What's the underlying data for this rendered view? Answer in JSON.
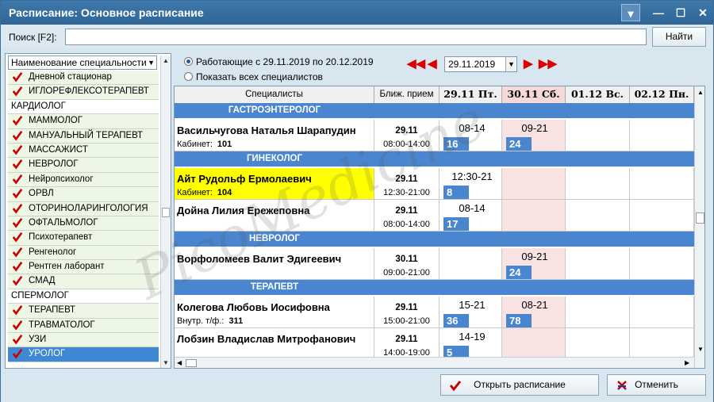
{
  "window": {
    "title": "Расписание:  Основное расписание"
  },
  "search": {
    "label": "Поиск [F2]:",
    "value": "",
    "button": "Найти"
  },
  "specialties": {
    "header": "Наименование специальности",
    "items": [
      {
        "label": "Дневной стационар",
        "checked": true
      },
      {
        "label": "ИГЛОРЕФЛЕКСОТЕРАПЕВТ",
        "checked": true
      },
      {
        "label": "КАРДИОЛОГ",
        "checked": false
      },
      {
        "label": "МАММОЛОГ",
        "checked": true
      },
      {
        "label": "МАНУАЛЬНЫЙ ТЕРАПЕВТ",
        "checked": true
      },
      {
        "label": "МАССАЖИСТ",
        "checked": true
      },
      {
        "label": "НЕВРОЛОГ",
        "checked": true
      },
      {
        "label": "Нейропсихолог",
        "checked": true
      },
      {
        "label": "ОРВЛ",
        "checked": true
      },
      {
        "label": "ОТОРИНОЛАРИНГОЛОГИЯ",
        "checked": true
      },
      {
        "label": "ОФТАЛЬМОЛОГ",
        "checked": true
      },
      {
        "label": "Психотерапевт",
        "checked": true
      },
      {
        "label": "Ренгенолог",
        "checked": true
      },
      {
        "label": "Рентген лаборант",
        "checked": true
      },
      {
        "label": "СМАД",
        "checked": true
      },
      {
        "label": "СПЕРМОЛОГ",
        "checked": false
      },
      {
        "label": "ТЕРАПЕВТ",
        "checked": true
      },
      {
        "label": "ТРАВМАТОЛОГ",
        "checked": true
      },
      {
        "label": "УЗИ",
        "checked": true
      },
      {
        "label": "УРОЛОГ",
        "checked": true,
        "selected": true
      }
    ]
  },
  "filter": {
    "option1": "Работающие с 29.11.2019 по 20.12.2019",
    "option2": "Показать всех специалистов",
    "date": "29.11.2019"
  },
  "grid": {
    "columns": [
      "Специалисты",
      "Ближ. прием",
      "29.11 Пт.",
      "30.11 Сб.",
      "01.12 Вс.",
      "02.12 Пн."
    ],
    "rows": [
      {
        "type": "group",
        "label": "ГАСТРОЭНТЕРОЛОГ"
      },
      {
        "type": "doc",
        "name": "Васильчугова Наталья Шарапудин",
        "sub_label": "Кабинет:",
        "sub_value": "101",
        "near_date": "29.11",
        "near_time": "08:00-14:00",
        "slots": [
          {
            "time": "08-14",
            "count": "16"
          },
          {
            "time": "09-21",
            "count": "24"
          },
          null,
          null
        ]
      },
      {
        "type": "group",
        "label": "ГИНЕКОЛОГ"
      },
      {
        "type": "doc",
        "highlight": true,
        "name": "Айт Рудольф Ермолаевич",
        "sub_label": "Кабинет:",
        "sub_value": "104",
        "near_date": "29.11",
        "near_time": "12:30-21:00",
        "slots": [
          {
            "time": "12:30-21",
            "count": "8"
          },
          null,
          null,
          null
        ]
      },
      {
        "type": "doc",
        "name": "Дойна Лилия Ережеповна",
        "sub_label": "",
        "sub_value": "",
        "near_date": "29.11",
        "near_time": "08:00-14:00",
        "slots": [
          {
            "time": "08-14",
            "count": "17"
          },
          null,
          null,
          null
        ]
      },
      {
        "type": "group",
        "label": "НЕВРОЛОГ"
      },
      {
        "type": "doc",
        "name": "Ворфоломеев Валит Эдигеевич",
        "sub_label": "",
        "sub_value": "",
        "near_date": "30.11",
        "near_time": "09:00-21:00",
        "slots": [
          null,
          {
            "time": "09-21",
            "count": "24"
          },
          null,
          null
        ]
      },
      {
        "type": "group",
        "label": "ТЕРАПЕВТ"
      },
      {
        "type": "doc",
        "name": "Колегова Любовь Иосифовна",
        "sub_label": "Внутр. т/ф.:",
        "sub_value": "311",
        "near_date": "29.11",
        "near_time": "15:00-21:00",
        "slots": [
          {
            "time": "15-21",
            "count": "36"
          },
          {
            "time": "08-21",
            "count": "78"
          },
          null,
          null
        ]
      },
      {
        "type": "doc",
        "name": "Лобзин Владислав Митрофанович",
        "sub_label": "",
        "sub_value": "",
        "near_date": "29.11",
        "near_time": "14:00-19:00",
        "slots": [
          {
            "time": "14-19",
            "count": "5"
          },
          null,
          null,
          null
        ]
      }
    ]
  },
  "footer": {
    "open": "Открыть расписание",
    "cancel": "Отменить"
  },
  "watermark": "PicoMedicine"
}
